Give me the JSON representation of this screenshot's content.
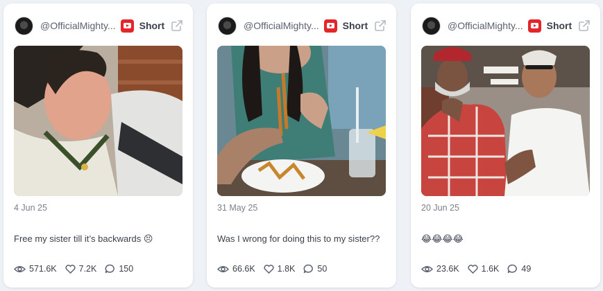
{
  "cards": [
    {
      "handle": "@OfficialMighty...",
      "platform_icon": "youtube-icon",
      "type_label": "Short",
      "date": "4 Jun 25",
      "caption": "Free my sister till it’s backwards 😣",
      "stats": {
        "views": "571.6K",
        "likes": "7.2K",
        "comments": "150"
      }
    },
    {
      "handle": "@OfficialMighty...",
      "platform_icon": "youtube-icon",
      "type_label": "Short",
      "date": "31 May 25",
      "caption": "Was I wrong for doing this to my sister??",
      "stats": {
        "views": "66.6K",
        "likes": "1.8K",
        "comments": "50"
      }
    },
    {
      "handle": "@OfficialMighty...",
      "platform_icon": "youtube-icon",
      "type_label": "Short",
      "date": "20 Jun 25",
      "caption": "😂😂😂😂",
      "stats": {
        "views": "23.6K",
        "likes": "1.6K",
        "comments": "49"
      }
    }
  ],
  "colors": {
    "page_bg": "#eef1f6",
    "card_bg": "#ffffff",
    "youtube_red": "#e4262a",
    "text_primary": "#3a3f4b",
    "text_muted": "#7a808c"
  }
}
